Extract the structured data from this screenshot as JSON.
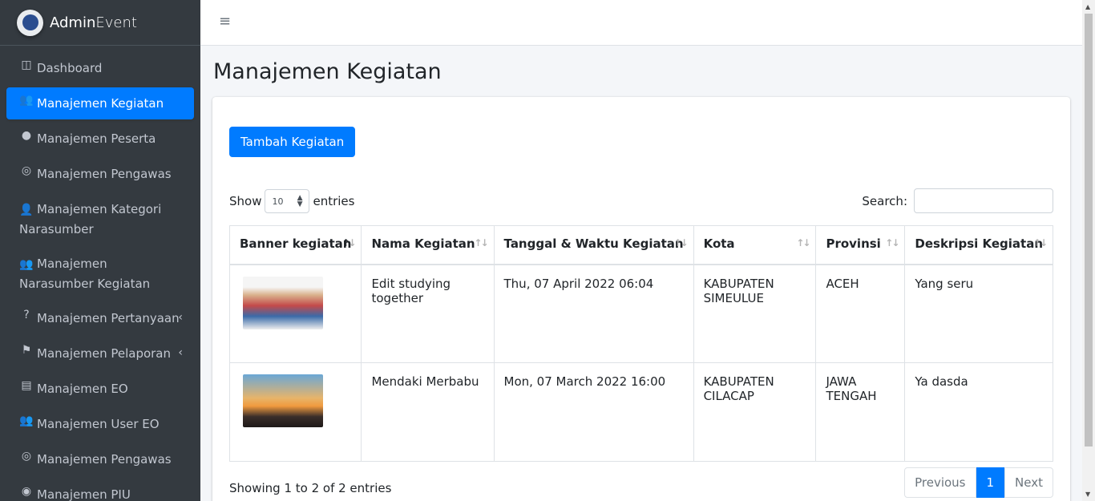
{
  "brand": {
    "name_bold": "Admin",
    "name_rest": "Event"
  },
  "sidebar": {
    "items": [
      {
        "icon": "columns-icon",
        "glyph": "◫",
        "label": "Dashboard"
      },
      {
        "icon": "users-icon",
        "glyph": "👥",
        "label": "Manajemen Kegiatan"
      },
      {
        "icon": "user-circle-icon",
        "glyph": "●",
        "label": "Manajemen Peserta"
      },
      {
        "icon": "mask-icon",
        "glyph": "◎",
        "label": "Manajemen Pengawas"
      },
      {
        "icon": "user-tag-icon",
        "glyph": "👤",
        "label": "Manajemen Kategori Narasumber"
      },
      {
        "icon": "users-icon",
        "glyph": "👥",
        "label": "Manajemen Narasumber Kegiatan"
      },
      {
        "icon": "question-icon",
        "glyph": "?",
        "label": "Manajemen Pertanyaan"
      },
      {
        "icon": "flag-icon",
        "glyph": "⚑",
        "label": "Manajemen Pelaporan"
      },
      {
        "icon": "book-icon",
        "glyph": "▤",
        "label": "Manajemen EO"
      },
      {
        "icon": "users-icon",
        "glyph": "👥",
        "label": "Manajemen User EO"
      },
      {
        "icon": "mask-icon",
        "glyph": "◎",
        "label": "Manajemen Pengawas"
      },
      {
        "icon": "fingerprint-icon",
        "glyph": "◉",
        "label": "Manajemen PIU"
      }
    ]
  },
  "header": {
    "hamburger": "≡"
  },
  "page": {
    "title": "Manajemen Kegiatan"
  },
  "toolbar": {
    "add_label": "Tambah Kegiatan"
  },
  "table_controls": {
    "show_label": "Show",
    "entries_value": "10",
    "entries_label": "entries",
    "search_label": "Search:"
  },
  "table": {
    "columns": [
      "Banner kegiatan",
      "Nama Kegiatan",
      "Tanggal & Waktu Kegiatan",
      "Kota",
      "Provinsi",
      "Deskripsi Kegiatan"
    ],
    "rows": [
      {
        "name": "Edit studying together",
        "datetime": "Thu, 07 April 2022 06:04",
        "city": "KABUPATEN SIMEULUE",
        "province": "ACEH",
        "description": "Yang seru"
      },
      {
        "name": "Mendaki Merbabu",
        "datetime": "Mon, 07 March 2022 16:00",
        "city": "KABUPATEN CILACAP",
        "province": "JAWA TENGAH",
        "description": "Ya dasda"
      }
    ]
  },
  "footer": {
    "info": "Showing 1 to 2 of 2 entries",
    "previous": "Previous",
    "current_page": "1",
    "next": "Next"
  },
  "colors": {
    "primary": "#007bff",
    "sidebar_bg": "#343a40"
  }
}
